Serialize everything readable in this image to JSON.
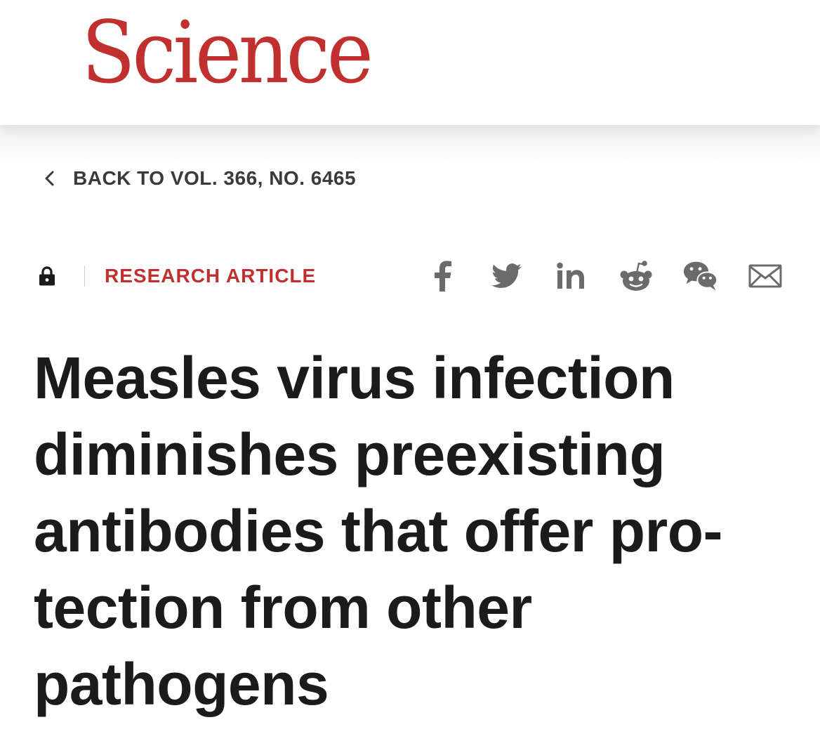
{
  "header": {
    "logo_text": "Science",
    "brand_color": "#c0302f"
  },
  "breadcrumb": {
    "back_label": "BACK TO VOL. 366, NO. 6465",
    "icon": "chevron-left-icon"
  },
  "article_meta": {
    "access_icon": "lock-icon",
    "article_type": "RESEARCH ARTICLE"
  },
  "share": {
    "icons": [
      "facebook-icon",
      "twitter-icon",
      "linkedin-icon",
      "reddit-icon",
      "wechat-icon",
      "email-icon"
    ]
  },
  "article": {
    "title_lines": [
      "Measles virus infection",
      "diminishes preexisting",
      "antibodies that offer pro-",
      "tection from other",
      "pathogens"
    ]
  },
  "colors": {
    "text": "#1b1b1b",
    "icon": "#6b6b6b",
    "background": "#ffffff"
  }
}
